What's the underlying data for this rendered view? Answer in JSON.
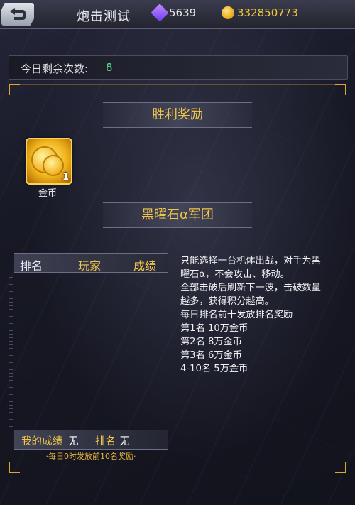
{
  "header": {
    "title": "炮击测试",
    "back_icon": "back-arrow-icon",
    "gems": "5639",
    "gold": "332850773",
    "gem_icon": "gem-icon",
    "gold_icon": "gold-coin-icon"
  },
  "remaining": {
    "label": "今日剩余次数:",
    "value": "8"
  },
  "victory_reward": {
    "title": "胜利奖励",
    "item_name": "金币",
    "item_count": "1",
    "item_icon": "gold-coins-icon"
  },
  "legion": {
    "title": "黑曜石α军团"
  },
  "ranking": {
    "col_rank": "排名",
    "col_player": "玩家",
    "col_score": "成绩"
  },
  "rules": [
    "只能选择一台机体出战，对手为黑",
    "曜石α，不会攻击、移动。",
    "全部击破后刷新下一波，击破数量",
    "越多，获得积分越高。",
    "每日排名前十发放排名奖励",
    "第1名 10万金币",
    "第2名 8万金币",
    "第3名 6万金币",
    "4-10名 5万金币"
  ],
  "my_result": {
    "score_label": "我的成绩",
    "score_value": "无",
    "rank_label": "排名",
    "rank_value": "无"
  },
  "footer_note": "·每日0时发放前10名奖励·",
  "colors": {
    "accent_gold": "#f0c54a",
    "remaining_value": "#5fe08a",
    "frame_corner": "#e2a42a"
  }
}
